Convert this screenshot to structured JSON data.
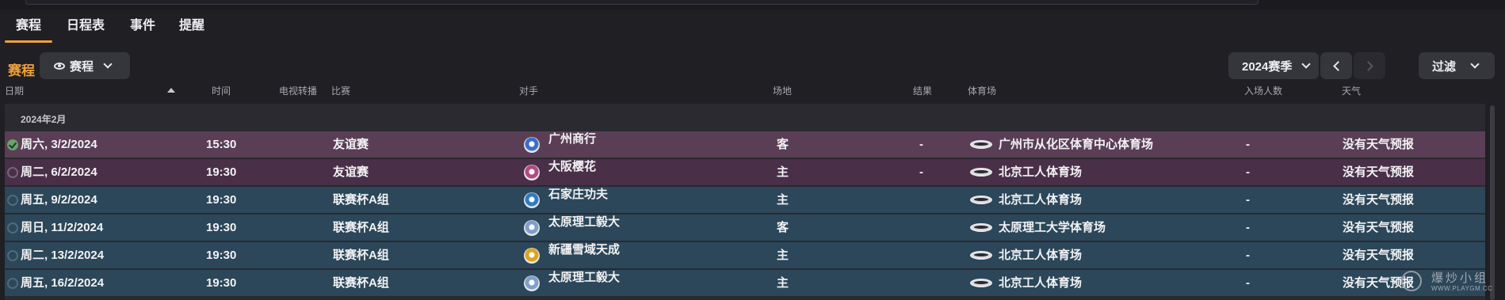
{
  "tabs": [
    {
      "label": "赛程"
    },
    {
      "label": "日程表"
    },
    {
      "label": "事件"
    },
    {
      "label": "提醒"
    }
  ],
  "toolbar": {
    "section_title": "赛程",
    "view_dropdown": "赛程",
    "season_dropdown": "2024赛季",
    "filter_button": "过滤"
  },
  "columns": {
    "date": "日期",
    "time": "时间",
    "tv": "电视转播",
    "competition": "比赛",
    "opponent": "对手",
    "venue": "场地",
    "result": "结果",
    "stadium": "体育场",
    "attendance": "入场人数",
    "weather": "天气"
  },
  "month_group": "2024年2月",
  "rows": [
    {
      "date": "周六, 3/2/2024",
      "time": "15:30",
      "competition": "友谊赛",
      "opponent": "广州商行",
      "venue": "客",
      "result": "-",
      "stadium": "广州市从化区体育中心体育场",
      "attendance": "-",
      "weather": "没有天气预报",
      "badge_color": "#3b6fc4"
    },
    {
      "date": "周二, 6/2/2024",
      "time": "19:30",
      "competition": "友谊赛",
      "opponent": "大阪樱花",
      "venue": "主",
      "result": "-",
      "stadium": "北京工人体育场",
      "attendance": "-",
      "weather": "没有天气预报",
      "badge_color": "#b04a86"
    },
    {
      "date": "周五, 9/2/2024",
      "time": "19:30",
      "competition": "联赛杯A组",
      "opponent": "石家庄功夫",
      "venue": "主",
      "result": "",
      "stadium": "北京工人体育场",
      "attendance": "-",
      "weather": "没有天气预报",
      "badge_color": "#2f7bc0"
    },
    {
      "date": "周日, 11/2/2024",
      "time": "19:30",
      "competition": "联赛杯A组",
      "opponent": "太原理工毅大",
      "venue": "客",
      "result": "",
      "stadium": "太原理工大学体育场",
      "attendance": "-",
      "weather": "没有天气预报",
      "badge_color": "#7f9fc8"
    },
    {
      "date": "周二, 13/2/2024",
      "time": "19:30",
      "competition": "联赛杯A组",
      "opponent": "新疆雪域天成",
      "venue": "主",
      "result": "",
      "stadium": "北京工人体育场",
      "attendance": "-",
      "weather": "没有天气预报",
      "badge_color": "#d9a520"
    },
    {
      "date": "周五, 16/2/2024",
      "time": "19:30",
      "competition": "联赛杯A组",
      "opponent": "太原理工毅大",
      "venue": "主",
      "result": "",
      "stadium": "北京工人体育场",
      "attendance": "-",
      "weather": "没有天气预报",
      "badge_color": "#7f9fc8"
    }
  ],
  "watermark": {
    "text": "爆炒小组",
    "url": "WWW.PLAYGM.CC"
  }
}
